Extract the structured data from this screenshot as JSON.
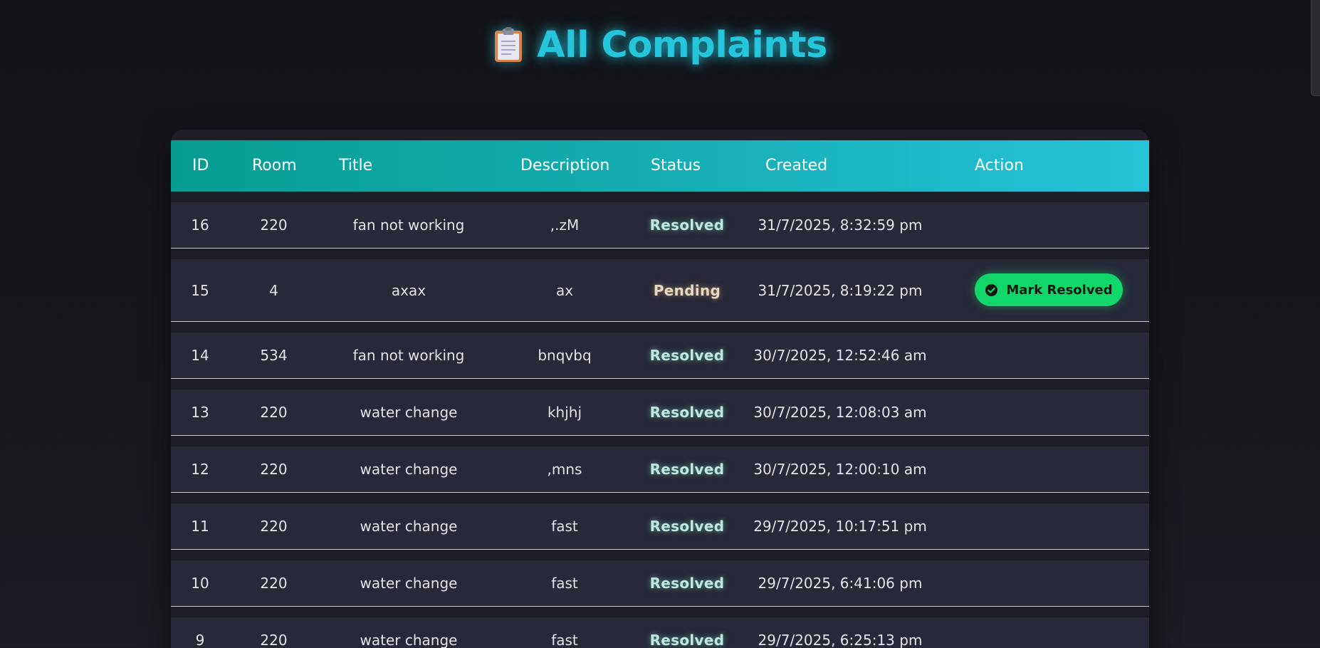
{
  "page": {
    "title": "All Complaints",
    "title_icon": "clipboard-icon"
  },
  "table": {
    "columns": [
      "ID",
      "Room",
      "Title",
      "Description",
      "Status",
      "Created",
      "Action"
    ],
    "rows": [
      {
        "id": "16",
        "room": "220",
        "title": "fan not working",
        "description": ",.zM",
        "status": "Resolved",
        "created": "31/7/2025, 8:32:59 pm",
        "action": ""
      },
      {
        "id": "15",
        "room": "4",
        "title": "axax",
        "description": "ax",
        "status": "Pending",
        "created": "31/7/2025, 8:19:22 pm",
        "action": "Mark Resolved"
      },
      {
        "id": "14",
        "room": "534",
        "title": "fan not working",
        "description": "bnqvbq",
        "status": "Resolved",
        "created": "30/7/2025, 12:52:46 am",
        "action": ""
      },
      {
        "id": "13",
        "room": "220",
        "title": "water change",
        "description": "khjhj",
        "status": "Resolved",
        "created": "30/7/2025, 12:08:03 am",
        "action": ""
      },
      {
        "id": "12",
        "room": "220",
        "title": "water change",
        "description": ",mns",
        "status": "Resolved",
        "created": "30/7/2025, 12:00:10 am",
        "action": ""
      },
      {
        "id": "11",
        "room": "220",
        "title": "water change",
        "description": "fast",
        "status": "Resolved",
        "created": "29/7/2025, 10:17:51 pm",
        "action": ""
      },
      {
        "id": "10",
        "room": "220",
        "title": "water change",
        "description": "fast",
        "status": "Resolved",
        "created": "29/7/2025, 6:41:06 pm",
        "action": ""
      },
      {
        "id": "9",
        "room": "220",
        "title": "water change",
        "description": "fast",
        "status": "Resolved",
        "created": "29/7/2025, 6:25:13 pm",
        "action": ""
      }
    ]
  },
  "colors": {
    "accent": "#25c6dc",
    "header_gradient_start": "#079d92",
    "header_gradient_end": "#26c3d8",
    "resolved": "#bfe8df",
    "pending": "#e6d9c0",
    "button": "#11d66a",
    "row_bg": "#272838"
  },
  "icons": {
    "button_icon": "check-circle-icon"
  }
}
